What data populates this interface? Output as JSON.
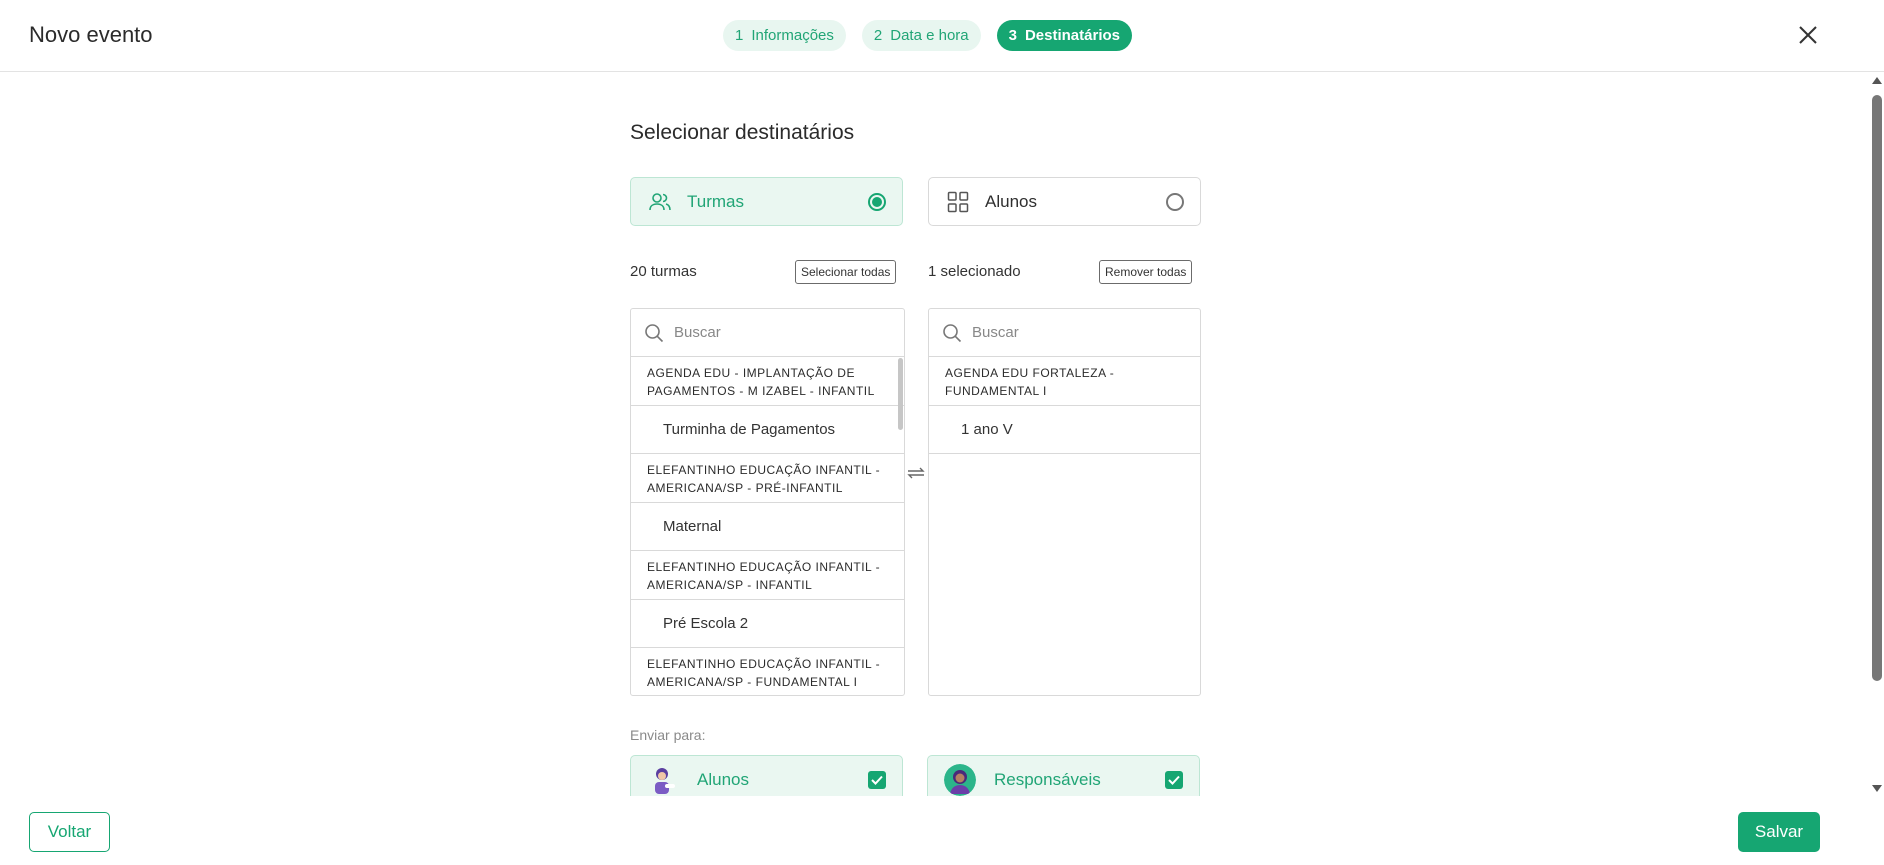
{
  "header": {
    "title": "Novo evento",
    "steps": [
      {
        "num": "1",
        "label": "Informações"
      },
      {
        "num": "2",
        "label": "Data e hora"
      },
      {
        "num": "3",
        "label": "Destinatários"
      }
    ],
    "active_step": 3
  },
  "main": {
    "section_title": "Selecionar destinatários",
    "recipient_types": [
      {
        "label": "Turmas",
        "icon": "users-icon",
        "selected": true
      },
      {
        "label": "Alunos",
        "icon": "grid-icon",
        "selected": false
      }
    ],
    "available": {
      "count_text": "20 turmas",
      "action_label": "Selecionar todas",
      "search_placeholder": "Buscar",
      "groups": [
        {
          "header": "AGENDA EDU - IMPLANTAÇÃO DE PAGAMENTOS - M IZABEL - INFANTIL",
          "items": [
            "Turminha de Pagamentos"
          ]
        },
        {
          "header": "ELEFANTINHO EDUCAÇÃO INFANTIL - AMERICANA/SP - PRÉ-INFANTIL",
          "items": [
            "Maternal"
          ]
        },
        {
          "header": "ELEFANTINHO EDUCAÇÃO INFANTIL - AMERICANA/SP - INFANTIL",
          "items": [
            "Pré Escola 2"
          ]
        },
        {
          "header": "ELEFANTINHO EDUCAÇÃO INFANTIL - AMERICANA/SP - FUNDAMENTAL I",
          "items": []
        }
      ]
    },
    "selected": {
      "count_text": "1 selecionado",
      "action_label": "Remover todas",
      "search_placeholder": "Buscar",
      "groups": [
        {
          "header": "AGENDA EDU FORTALEZA - FUNDAMENTAL I",
          "items": [
            "1 ano V"
          ]
        }
      ]
    },
    "send_to": {
      "label": "Enviar para:",
      "options": [
        {
          "label": "Alunos",
          "checked": true
        },
        {
          "label": "Responsáveis",
          "checked": true
        }
      ]
    }
  },
  "footer": {
    "back_label": "Voltar",
    "save_label": "Salvar"
  },
  "colors": {
    "accent": "#16a672",
    "accent_light": "#eaf7f1",
    "border": "#d9d9d9"
  }
}
